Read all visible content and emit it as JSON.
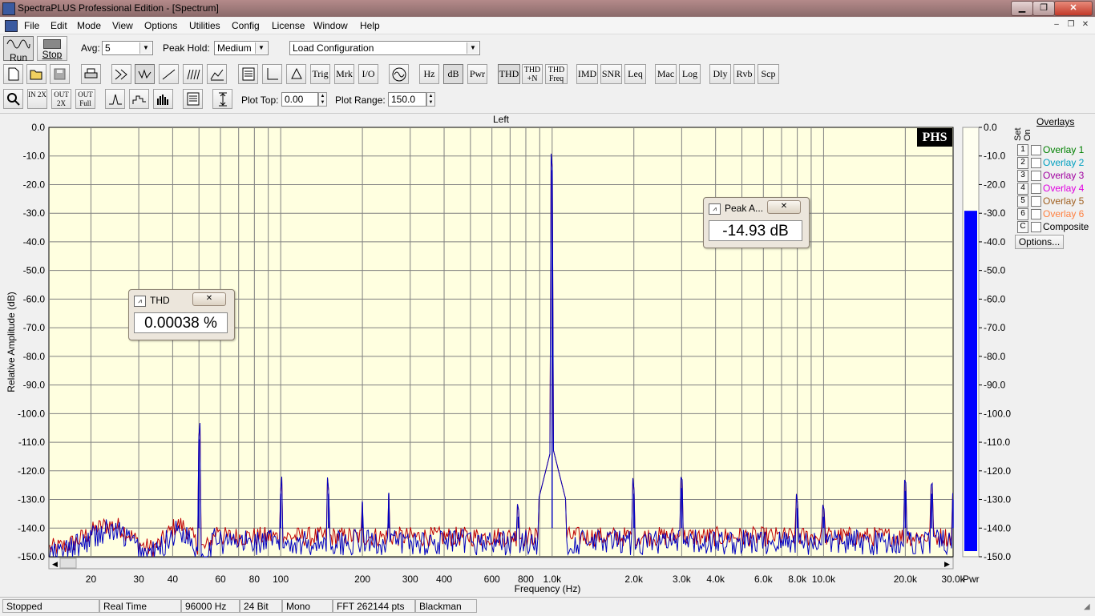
{
  "window": {
    "title": "SpectraPLUS Professional Edition - [Spectrum]",
    "min_glyph": "▁",
    "max_glyph": "❐",
    "close_glyph": "✕"
  },
  "menu": [
    "File",
    "Edit",
    "Mode",
    "View",
    "Options",
    "Utilities",
    "Config",
    "License",
    "Window",
    "Help"
  ],
  "mdi_controls": [
    "–",
    "❐",
    "✕"
  ],
  "toolbar1": {
    "run_label": "Run",
    "stop_label": "Stop",
    "avg_label": "Avg:",
    "avg_value": "5",
    "peak_hold_label": "Peak Hold:",
    "peak_hold_value": "Medium",
    "config_value": "Load Configuration"
  },
  "toolbar2": {
    "text_buttons": [
      "Trig",
      "Mrk",
      "I/O",
      "Hz",
      "dB",
      "Pwr",
      "THD",
      "THD +N",
      "THD Freq",
      "IMD",
      "SNR",
      "Leq",
      "Mac",
      "Log",
      "Dly",
      "Rvb",
      "Scp"
    ]
  },
  "toolbar3": {
    "zoom_buttons": [
      "IN 2X",
      "OUT 2X",
      "OUT Full"
    ],
    "plot_top_label": "Plot Top:",
    "plot_top_value": "0.00",
    "plot_range_label": "Plot Range:",
    "plot_range_value": "150.0"
  },
  "colors": {
    "plot_bg": "#ffffe0",
    "grid": "#808080",
    "series_blue": "#0000c0",
    "series_red": "#c00000",
    "bar_fill": "#0000ff"
  },
  "chart_data": {
    "type": "line",
    "title": "Left",
    "xlabel": "Frequency (Hz)",
    "ylabel": "Relative Amplitude (dB)",
    "x_scale": "log",
    "xlim": [
      14,
      30000
    ],
    "ylim": [
      -150,
      0
    ],
    "yticks": [
      "0.0",
      "-10.0",
      "-20.0",
      "-30.0",
      "-40.0",
      "-50.0",
      "-60.0",
      "-70.0",
      "-80.0",
      "-90.0",
      "-100.0",
      "-110.0",
      "-120.0",
      "-130.0",
      "-140.0",
      "-150.0"
    ],
    "xticks": [
      {
        "v": 20,
        "label": "20"
      },
      {
        "v": 30,
        "label": "30"
      },
      {
        "v": 40,
        "label": "40"
      },
      {
        "v": 60,
        "label": "60"
      },
      {
        "v": 80,
        "label": "80"
      },
      {
        "v": 100,
        "label": "100"
      },
      {
        "v": 200,
        "label": "200"
      },
      {
        "v": 300,
        "label": "300"
      },
      {
        "v": 400,
        "label": "400"
      },
      {
        "v": 600,
        "label": "600"
      },
      {
        "v": 800,
        "label": "800"
      },
      {
        "v": 1000,
        "label": "1.0k"
      },
      {
        "v": 2000,
        "label": "2.0k"
      },
      {
        "v": 3000,
        "label": "3.0k"
      },
      {
        "v": 4000,
        "label": "4.0k"
      },
      {
        "v": 6000,
        "label": "6.0k"
      },
      {
        "v": 8000,
        "label": "8.0k"
      },
      {
        "v": 10000,
        "label": "10.0k"
      },
      {
        "v": 20000,
        "label": "20.0k"
      },
      {
        "v": 30000,
        "label": "30.0k"
      }
    ],
    "grid": true,
    "noise_floor_db": -145,
    "peaks": [
      {
        "x": 50,
        "y": -109
      },
      {
        "x": 100,
        "y": -128
      },
      {
        "x": 150,
        "y": -128
      },
      {
        "x": 200,
        "y": -131
      },
      {
        "x": 250,
        "y": -128
      },
      {
        "x": 750,
        "y": -136
      },
      {
        "x": 1000,
        "y": -14.93
      },
      {
        "x": 2000,
        "y": -128
      },
      {
        "x": 3000,
        "y": -126
      },
      {
        "x": 8000,
        "y": -133
      },
      {
        "x": 10000,
        "y": -136
      },
      {
        "x": 20000,
        "y": -127
      },
      {
        "x": 25000,
        "y": -128
      },
      {
        "x": 30000,
        "y": -130
      }
    ],
    "level_bar": {
      "ticks": [
        "0.0",
        "-10.0",
        "-20.0",
        "-30.0",
        "-40.0",
        "-50.0",
        "-60.0",
        "-70.0",
        "-80.0",
        "-90.0",
        "-100.0",
        "-110.0",
        "-120.0",
        "-130.0",
        "-140.0",
        "-150.0"
      ],
      "level_db": -14.6,
      "label": "Pwr"
    }
  },
  "logo_text": "PHS",
  "thd_popup": {
    "title": "THD",
    "value": "0.00038 %",
    "close_glyph": "✕"
  },
  "peak_popup": {
    "title": "Peak A...",
    "value": "-14.93 dB",
    "close_glyph": "✕"
  },
  "overlays": {
    "title": "Overlays",
    "col_set": "Set",
    "col_on": "On",
    "items": [
      {
        "num": "1",
        "name": "Overlay 1",
        "color": "#008000"
      },
      {
        "num": "2",
        "name": "Overlay 2",
        "color": "#00a0c0"
      },
      {
        "num": "3",
        "name": "Overlay 3",
        "color": "#a000a0"
      },
      {
        "num": "4",
        "name": "Overlay 4",
        "color": "#e000e0"
      },
      {
        "num": "5",
        "name": "Overlay 5",
        "color": "#a06020"
      },
      {
        "num": "6",
        "name": "Overlay 6",
        "color": "#ff8040"
      },
      {
        "num": "C",
        "name": "Composite",
        "color": "#000000"
      }
    ],
    "options_label": "Options..."
  },
  "status": [
    "Stopped",
    "Real Time",
    "96000 Hz",
    "24 Bit",
    "Mono",
    "FFT 262144 pts",
    "Blackman"
  ]
}
